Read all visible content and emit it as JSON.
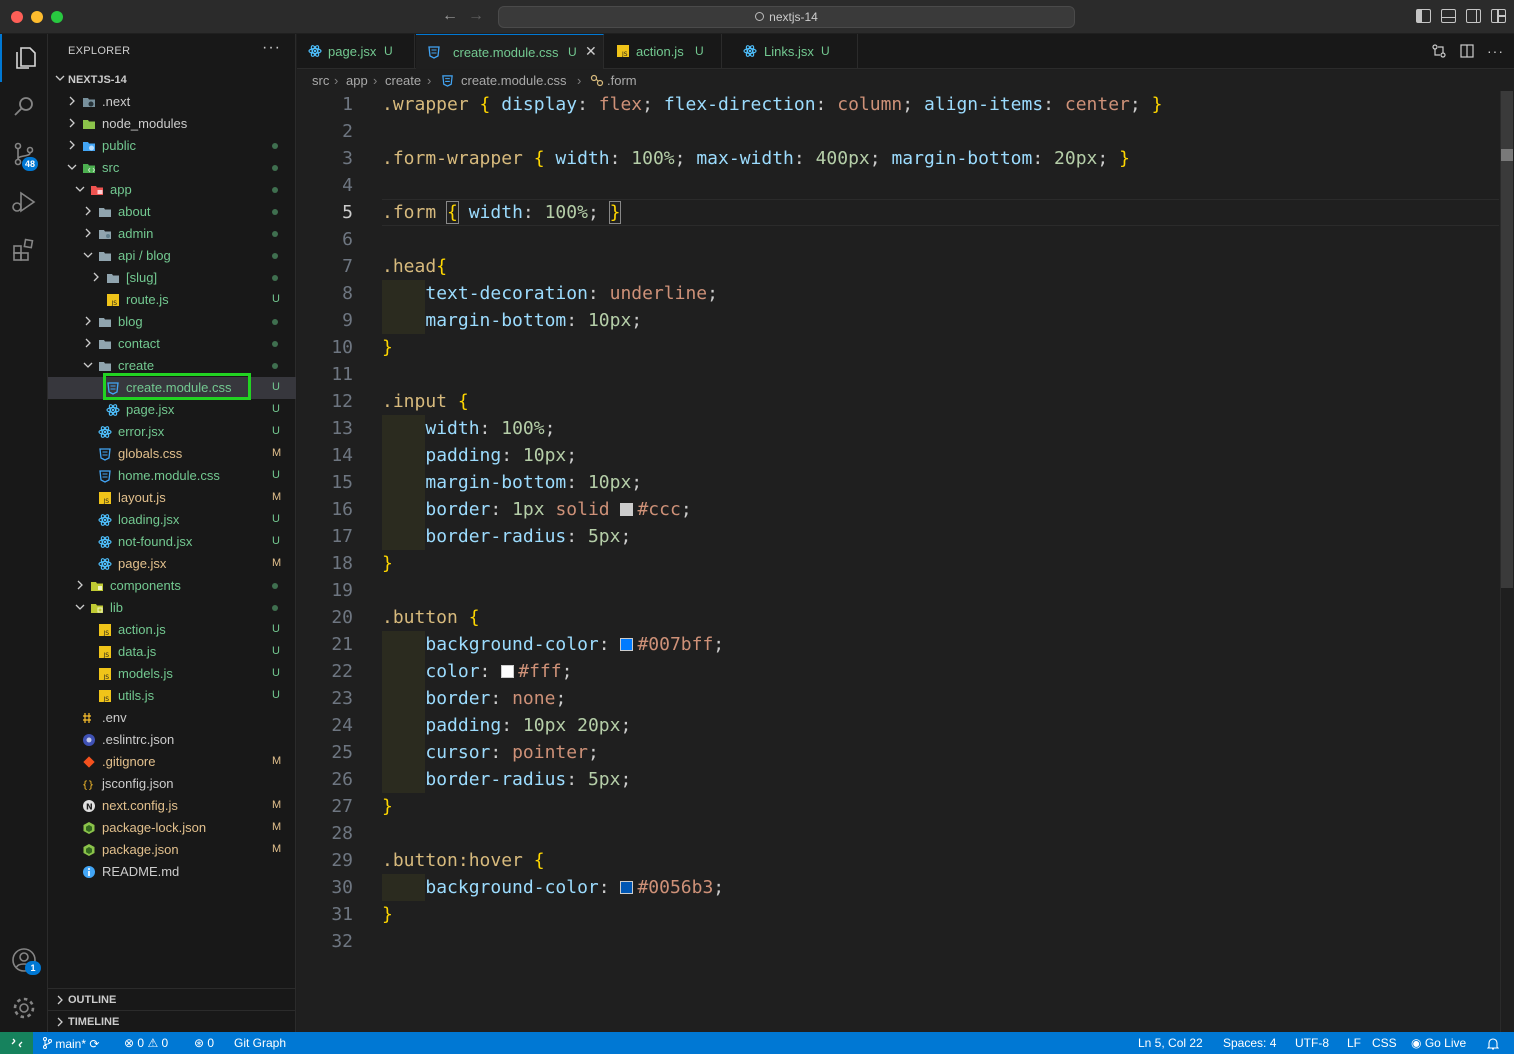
{
  "window": {
    "search_text": "nextjs-14"
  },
  "activity": {
    "source_control_badge": "48",
    "accounts_badge": "1"
  },
  "explorer": {
    "title": "EXPLORER",
    "more": "···",
    "project": "NEXTJS-14",
    "rows": [
      {
        "label": ".next",
        "status": ""
      },
      {
        "label": "node_modules",
        "status": ""
      },
      {
        "label": "public",
        "status": "dot"
      },
      {
        "label": "src",
        "status": "dot"
      },
      {
        "label": "app",
        "status": "dot"
      },
      {
        "label": "about",
        "status": "dot"
      },
      {
        "label": "admin",
        "status": "dot"
      },
      {
        "label": "api / blog",
        "status": "dot"
      },
      {
        "label": "[slug]",
        "status": "dot"
      },
      {
        "label": "route.js",
        "status": "U"
      },
      {
        "label": "blog",
        "status": "dot"
      },
      {
        "label": "contact",
        "status": "dot"
      },
      {
        "label": "create",
        "status": "dot"
      },
      {
        "label": "create.module.css",
        "status": "U"
      },
      {
        "label": "page.jsx",
        "status": "U"
      },
      {
        "label": "error.jsx",
        "status": "U"
      },
      {
        "label": "globals.css",
        "status": "M"
      },
      {
        "label": "home.module.css",
        "status": "U"
      },
      {
        "label": "layout.js",
        "status": "M"
      },
      {
        "label": "loading.jsx",
        "status": "U"
      },
      {
        "label": "not-found.jsx",
        "status": "U"
      },
      {
        "label": "page.jsx",
        "status": "M"
      },
      {
        "label": "components",
        "status": "dot"
      },
      {
        "label": "lib",
        "status": "dot"
      },
      {
        "label": "action.js",
        "status": "U"
      },
      {
        "label": "data.js",
        "status": "U"
      },
      {
        "label": "models.js",
        "status": "U"
      },
      {
        "label": "utils.js",
        "status": "U"
      },
      {
        "label": ".env",
        "status": ""
      },
      {
        "label": ".eslintrc.json",
        "status": ""
      },
      {
        "label": ".gitignore",
        "status": "M"
      },
      {
        "label": "jsconfig.json",
        "status": ""
      },
      {
        "label": "next.config.js",
        "status": "M"
      },
      {
        "label": "package-lock.json",
        "status": "M"
      },
      {
        "label": "package.json",
        "status": "M"
      },
      {
        "label": "README.md",
        "status": ""
      }
    ],
    "outline": "OUTLINE",
    "timeline": "TIMELINE"
  },
  "tabs": [
    {
      "label": "page.jsx",
      "status": "U"
    },
    {
      "label": "create.module.css",
      "status": "U",
      "close": "✕"
    },
    {
      "label": "action.js",
      "status": "U"
    },
    {
      "label": "Links.jsx",
      "status": "U"
    }
  ],
  "breadcrumb": [
    "src",
    "app",
    "create",
    "create.module.css",
    ".form"
  ],
  "editor": {
    "current_line": 5,
    "lines": [
      ".wrapper { display: flex; flex-direction: column; align-items: center; }",
      "",
      ".form-wrapper { width: 100%; max-width: 400px; margin-bottom: 20px; }",
      "",
      ".form { width: 100%; }",
      "",
      ".head{",
      "    text-decoration: underline;",
      "    margin-bottom: 10px;",
      "}",
      "",
      ".input {",
      "    width: 100%;",
      "    padding: 10px;",
      "    margin-bottom: 10px;",
      "    border: 1px solid #ccc;",
      "    border-radius: 5px;",
      "}",
      "",
      ".button {",
      "    background-color: #007bff;",
      "    color: #fff;",
      "    border: none;",
      "    padding: 10px 20px;",
      "    cursor: pointer;",
      "    border-radius: 5px;",
      "}",
      "",
      ".button:hover {",
      "    background-color: #0056b3;",
      "}",
      ""
    ]
  },
  "statusbar": {
    "branch": "main*",
    "errors": "0",
    "warnings": "0",
    "ports": "0",
    "git_graph": "Git Graph",
    "position": "Ln 5, Col 22",
    "spaces": "Spaces: 4",
    "encoding": "UTF-8",
    "eol": "LF",
    "language": "CSS",
    "go_live": "Go Live"
  },
  "colors": {
    "accent": "#0078d4",
    "untracked": "#73c991",
    "modified": "#e2c08d",
    "highlight_box": "#22d322"
  }
}
